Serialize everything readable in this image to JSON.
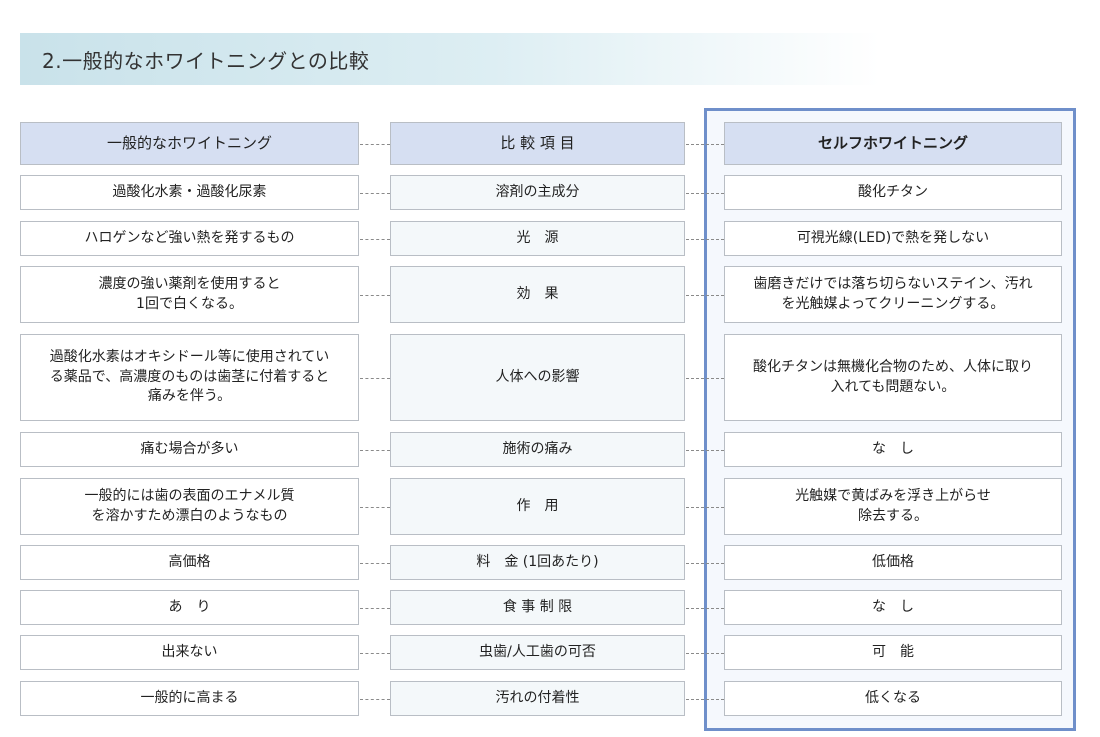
{
  "title": "2.一般的なホワイトニングとの比較",
  "headers": {
    "general": "一般的なホワイトニング",
    "item": "比 較 項 目",
    "self": "セルフホワイトニング"
  },
  "rows": [
    {
      "general": "過酸化水素・過酸化尿素",
      "item": "溶剤の主成分",
      "self": "酸化チタン"
    },
    {
      "general": "ハロゲンなど強い熱を発するもの",
      "item": "光　源",
      "self": "可視光線(LED)で熱を発しない"
    },
    {
      "general": "濃度の強い薬剤を使用すると\n1回で白くなる。",
      "item": "効　果",
      "self": "歯磨きだけでは落ち切らないステイン、汚れ\nを光触媒よってクリーニングする。"
    },
    {
      "general": "過酸化水素はオキシドール等に使用されてい\nる薬品で、高濃度のものは歯茎に付着すると\n痛みを伴う。",
      "item": "人体への影響",
      "self": "酸化チタンは無機化合物のため、人体に取り\n入れても問題ない。"
    },
    {
      "general": "痛む場合が多い",
      "item": "施術の痛み",
      "self": "な　し"
    },
    {
      "general": "一般的には歯の表面のエナメル質\nを溶かすため漂白のようなもの",
      "item": "作　用",
      "self": "光触媒で黄ばみを浮き上がらせ\n除去する。"
    },
    {
      "general": "高価格",
      "item": "料　金 (1回あたり)",
      "self": "低価格"
    },
    {
      "general": "あ　り",
      "item": "食 事 制 限",
      "self": "な　し"
    },
    {
      "general": "出来ない",
      "item": "虫歯/人工歯の可否",
      "self": "可　能"
    },
    {
      "general": "一般的に高まる",
      "item": "汚れの付着性",
      "self": "低くなる"
    }
  ]
}
